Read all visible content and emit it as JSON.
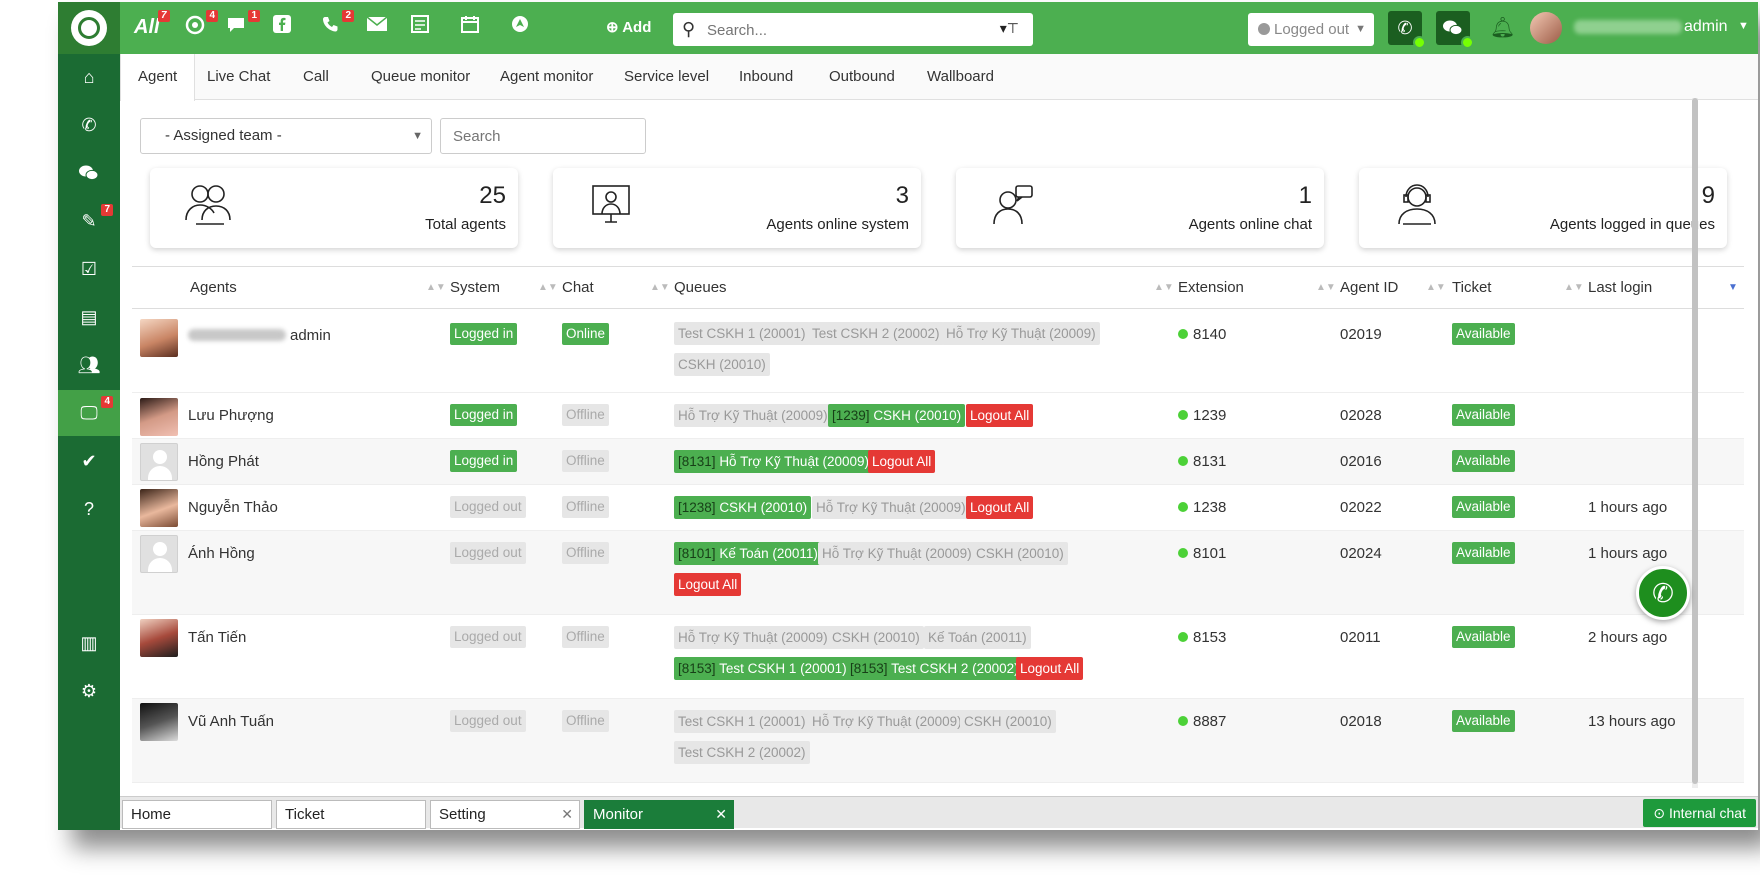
{
  "topbar": {
    "all_label": "All",
    "badges": {
      "all": "7",
      "tickets": "4",
      "chat": "1",
      "calls": "2"
    },
    "add_label": "Add",
    "search_placeholder": "Search...",
    "status_label": "Logged out",
    "user_name": "admin"
  },
  "sidebar": {
    "ticket_badge": "7",
    "monitor_badge": "4"
  },
  "tabs": [
    "Agent",
    "Live Chat",
    "Call",
    "Queue monitor",
    "Agent monitor",
    "Service level",
    "Inbound",
    "Outbound",
    "Wallboard"
  ],
  "filters": {
    "team_label": "- Assigned team -",
    "search_placeholder": "Search"
  },
  "stats": [
    {
      "value": "25",
      "label": "Total agents",
      "icon": "team-icon"
    },
    {
      "value": "3",
      "label": "Agents online system",
      "icon": "monitor-user-icon"
    },
    {
      "value": "1",
      "label": "Agents online chat",
      "icon": "chat-agent-icon"
    },
    {
      "value": "9",
      "label": "Agents logged in queues",
      "icon": "headset-agent-icon"
    }
  ],
  "table": {
    "headers": [
      "Agents",
      "System",
      "Chat",
      "Queues",
      "Extension",
      "Agent ID",
      "Ticket",
      "Last login"
    ],
    "rows": [
      {
        "name": "admin",
        "system": "Logged in",
        "chat": "Online",
        "extension": "8140",
        "agent_id": "02019",
        "ticket": "Available",
        "last_login": "",
        "queues": [
          [
            "",
            "Test CSKH 1 (20001)"
          ],
          [
            "",
            "Test CSKH 2 (20002)"
          ],
          [
            "",
            "Hỗ Trợ Kỹ Thuật (20009)"
          ],
          [
            "",
            "CSKH (20010)"
          ]
        ]
      },
      {
        "name": "Lưu Phượng",
        "system": "Logged in",
        "chat": "Offline",
        "extension": "1239",
        "agent_id": "02028",
        "ticket": "Available",
        "last_login": "",
        "queues": [
          [
            "",
            "Hỗ Trợ Kỹ Thuật (20009)"
          ],
          [
            "[1239]",
            "CSKH (20010)"
          ]
        ],
        "logout_all": "Logout All"
      },
      {
        "name": "Hồng Phát",
        "system": "Logged in",
        "chat": "Offline",
        "extension": "8131",
        "agent_id": "02016",
        "ticket": "Available",
        "last_login": "",
        "queues": [
          [
            "[8131]",
            "Hỗ Trợ Kỹ Thuật (20009)"
          ]
        ],
        "logout_all": "Logout All"
      },
      {
        "name": "Nguyễn Thảo",
        "system": "Logged out",
        "chat": "Offline",
        "extension": "1238",
        "agent_id": "02022",
        "ticket": "Available",
        "last_login": "1 hours ago",
        "queues": [
          [
            "[1238]",
            "CSKH (20010)"
          ],
          [
            "",
            "Hỗ Trợ Kỹ Thuật (20009)"
          ]
        ],
        "logout_all": "Logout All"
      },
      {
        "name": "Ánh Hồng",
        "system": "Logged out",
        "chat": "Offline",
        "extension": "8101",
        "agent_id": "02024",
        "ticket": "Available",
        "last_login": "1 hours ago",
        "queues": [
          [
            "[8101]",
            "Kế Toán (20011)"
          ],
          [
            "",
            "Hỗ Trợ Kỹ Thuật (20009)"
          ],
          [
            "",
            "CSKH (20010)"
          ]
        ],
        "logout_all": "Logout All"
      },
      {
        "name": "Tấn Tiến",
        "system": "Logged out",
        "chat": "Offline",
        "extension": "8153",
        "agent_id": "02011",
        "ticket": "Available",
        "last_login": "2 hours ago",
        "queues": [
          [
            "",
            "Hỗ Trợ Kỹ Thuật (20009)"
          ],
          [
            "",
            "CSKH (20010)"
          ],
          [
            "",
            "Kế Toán (20011)"
          ],
          [
            "[8153]",
            "Test CSKH 1 (20001)"
          ],
          [
            "[8153]",
            "Test CSKH 2 (20002)"
          ]
        ],
        "logout_all": "Logout All"
      },
      {
        "name": "Vũ Anh Tuấn",
        "system": "Logged out",
        "chat": "Offline",
        "extension": "8887",
        "agent_id": "02018",
        "ticket": "Available",
        "last_login": "13 hours ago",
        "queues": [
          [
            "",
            "Test CSKH 1 (20001)"
          ],
          [
            "",
            "Hỗ Trợ Kỹ Thuật (20009)"
          ],
          [
            "",
            "CSKH (20010)"
          ],
          [
            "",
            "Test CSKH 2 (20002)"
          ]
        ]
      }
    ]
  },
  "bottom_tabs": [
    "Home",
    "Ticket",
    "Setting",
    "Monitor"
  ],
  "internal_chat_label": "Internal chat",
  "colors": {
    "brand": "#4caf50",
    "sidebar": "#1b6b33",
    "danger": "#e53935"
  }
}
